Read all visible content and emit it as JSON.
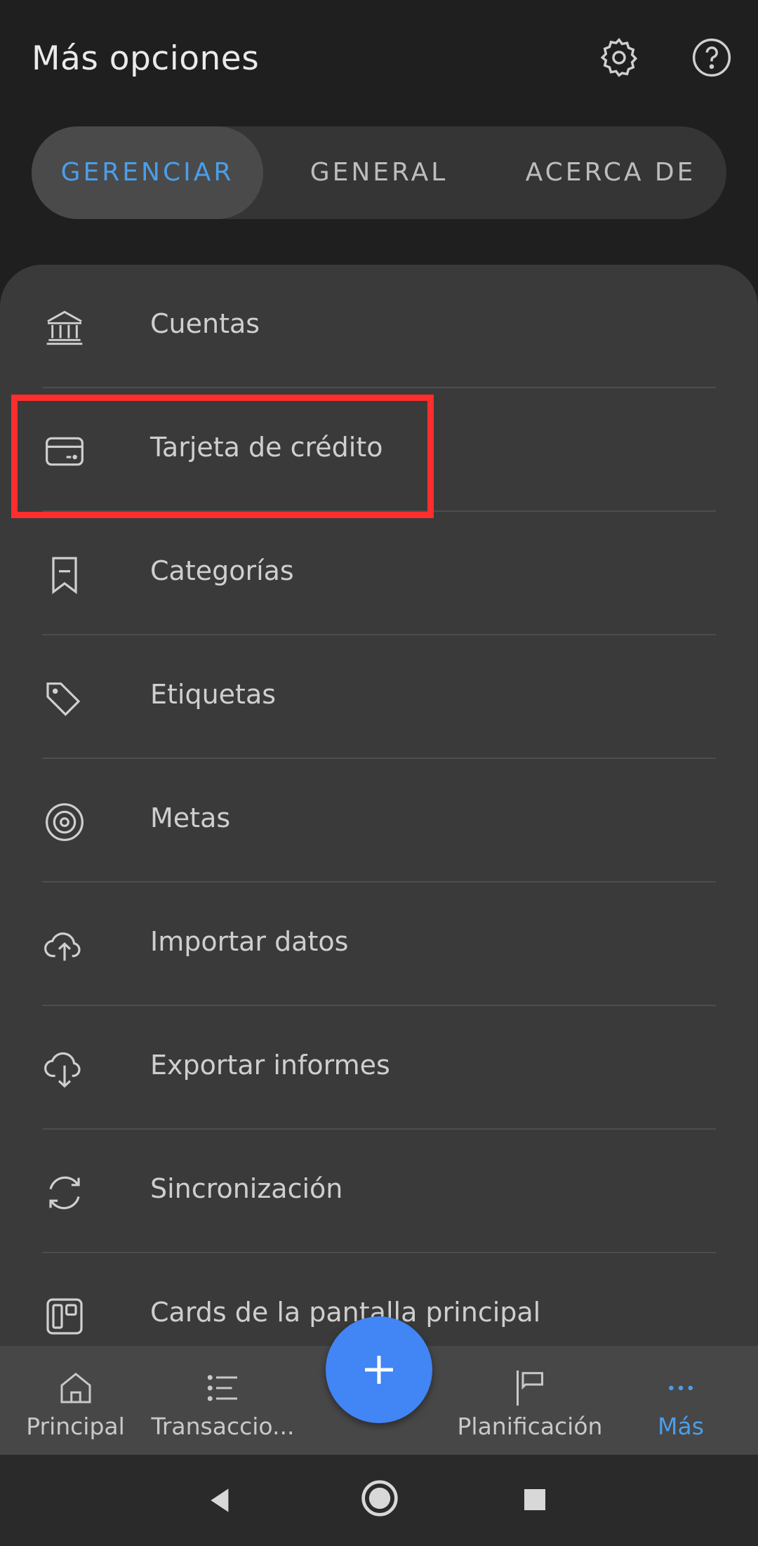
{
  "header": {
    "title": "Más opciones",
    "settings_icon": "gear-icon",
    "help_icon": "help-circle-icon"
  },
  "tabs": [
    {
      "label": "GERENCIAR",
      "active": true
    },
    {
      "label": "GENERAL",
      "active": false
    },
    {
      "label": "ACERCA DE",
      "active": false
    }
  ],
  "menu": {
    "items": [
      {
        "label": "Cuentas",
        "icon": "bank-icon"
      },
      {
        "label": "Tarjeta de crédito",
        "icon": "credit-card-icon"
      },
      {
        "label": "Categorías",
        "icon": "bookmark-icon"
      },
      {
        "label": "Etiquetas",
        "icon": "tag-icon"
      },
      {
        "label": "Metas",
        "icon": "target-icon"
      },
      {
        "label": "Importar datos",
        "icon": "cloud-upload-icon"
      },
      {
        "label": "Exportar informes",
        "icon": "cloud-download-icon"
      },
      {
        "label": "Sincronización",
        "icon": "sync-icon"
      },
      {
        "label": "Cards de la pantalla principal",
        "icon": "dashboard-cards-icon"
      }
    ]
  },
  "bottom_nav": {
    "items": [
      {
        "label": "Principal",
        "icon": "home-icon",
        "active": false
      },
      {
        "label": "Transaccio...",
        "icon": "list-icon",
        "active": false
      },
      {
        "label": "Planificación",
        "icon": "flag-icon",
        "active": false
      },
      {
        "label": "Más",
        "icon": "more-horizontal-icon",
        "active": true
      }
    ],
    "fab_icon": "plus-icon"
  },
  "system_nav": [
    "back-icon",
    "home-circle-icon",
    "recents-icon"
  ],
  "colors": {
    "accent": "#4a9eea",
    "fab": "#4285f4",
    "highlight": "#ff2d2d",
    "background": "#1f1f1f",
    "panel": "#3a3a3a"
  }
}
